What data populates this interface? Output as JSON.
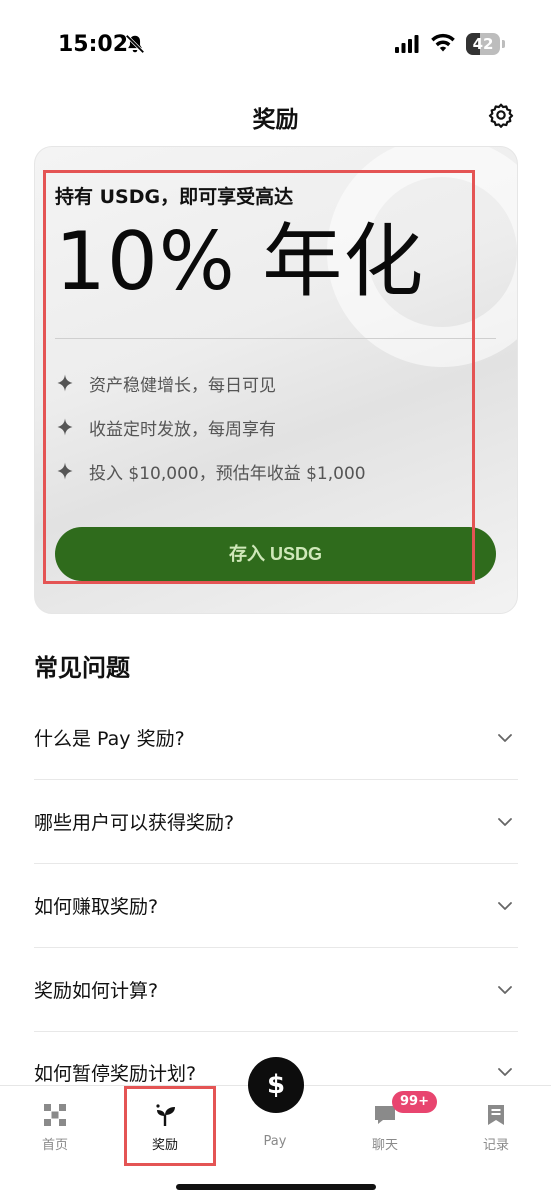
{
  "status_bar": {
    "time": "15:02",
    "battery": "42",
    "battery_percent": 42
  },
  "header": {
    "title": "奖励"
  },
  "promo": {
    "subtitle": "持有 USDG，即可享受高达",
    "rate": "10% 年化",
    "features": [
      "资产稳健增长，每日可见",
      "收益定时发放，每周享有",
      "投入 $10,000，预估年收益 $1,000"
    ],
    "button_label": "存入 USDG"
  },
  "faq": {
    "title": "常见问题",
    "items": [
      "什么是 Pay 奖励?",
      "哪些用户可以获得奖励?",
      "如何赚取奖励?",
      "奖励如何计算?",
      "如何暂停奖励计划?"
    ]
  },
  "tabbar": {
    "tabs": [
      {
        "label": "首页",
        "icon": "home-grid-icon"
      },
      {
        "label": "奖励",
        "icon": "sprout-icon"
      },
      {
        "label": "Pay",
        "icon": "dollar-icon"
      },
      {
        "label": "聊天",
        "icon": "chat-bubble-icon"
      },
      {
        "label": "记录",
        "icon": "bookmark-icon"
      }
    ],
    "pay_symbol": "$",
    "chat_badge": "99+"
  },
  "colors": {
    "accent_green": "#2f6b1c",
    "button_text": "#cfe8b9",
    "highlight": "#e45454",
    "badge": "#e8456f"
  }
}
